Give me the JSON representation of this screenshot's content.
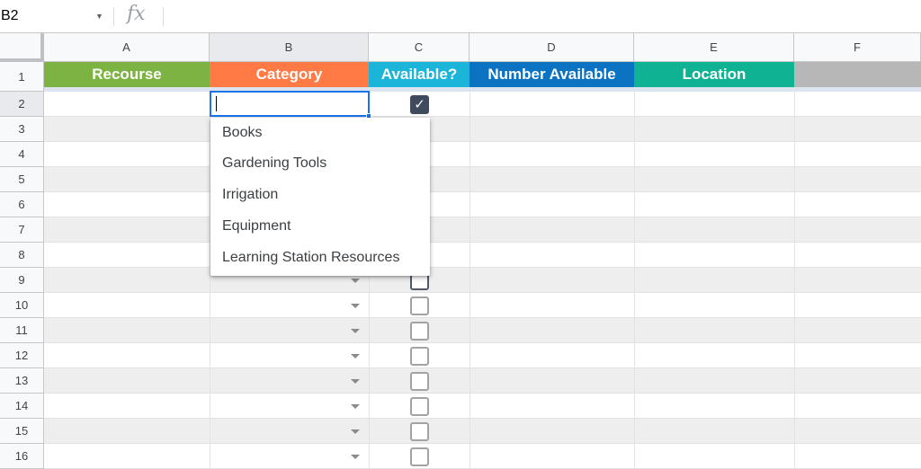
{
  "formula_bar": {
    "name_box": "B2",
    "fx_label": "fx",
    "formula_value": ""
  },
  "columns": [
    "A",
    "B",
    "C",
    "D",
    "E",
    "F"
  ],
  "rows": [
    "1",
    "2",
    "3",
    "4",
    "5",
    "6",
    "7",
    "8",
    "9",
    "10",
    "11",
    "12",
    "13",
    "14",
    "15",
    "16"
  ],
  "header_row": [
    {
      "label": "Recourse",
      "color": "#7cb342"
    },
    {
      "label": "Category",
      "color": "#ff7a45"
    },
    {
      "label": "Available?",
      "color": "#1ab5d8"
    },
    {
      "label": "Number Available",
      "color": "#0c72c2"
    },
    {
      "label": "Location",
      "color": "#10b294"
    },
    {
      "label": "",
      "color": "#b7b7b7"
    }
  ],
  "active_cell": {
    "ref": "B2",
    "value": ""
  },
  "availability_checkboxes": [
    {
      "row": "2",
      "checked": true
    },
    {
      "row": "9",
      "checked": false
    },
    {
      "row": "10",
      "checked": false
    },
    {
      "row": "11",
      "checked": false
    },
    {
      "row": "12",
      "checked": false
    },
    {
      "row": "13",
      "checked": false
    },
    {
      "row": "14",
      "checked": false
    },
    {
      "row": "15",
      "checked": false
    },
    {
      "row": "16",
      "checked": false
    }
  ],
  "category_dropdown": {
    "options": [
      "Books",
      "Gardening Tools",
      "Irrigation",
      "Equipment",
      "Learning Station Resources"
    ]
  },
  "colors": {
    "selection_blue": "#1a73e8",
    "checkbox_checked": "#3f4b5c",
    "band_gray": "#eeeeee"
  },
  "icons": {
    "name_box_caret": "caret-down-icon",
    "fx": "function-icon",
    "checkmark": "check-icon",
    "dropdown_arrow": "triangle-down-icon"
  }
}
